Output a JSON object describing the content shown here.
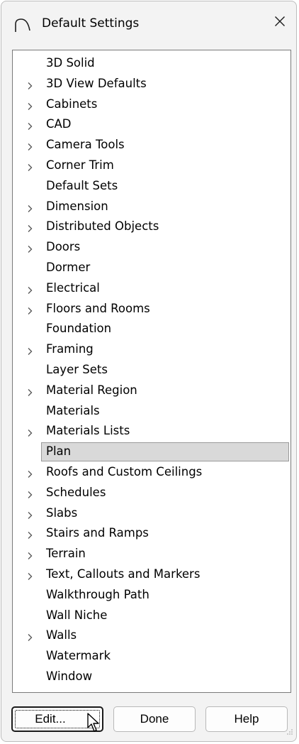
{
  "window": {
    "title": "Default Settings",
    "icon": "app-arc-icon",
    "close_icon": "close-icon"
  },
  "tree": {
    "items": [
      {
        "label": "3D Solid",
        "expandable": false
      },
      {
        "label": "3D View Defaults",
        "expandable": true
      },
      {
        "label": "Cabinets",
        "expandable": true
      },
      {
        "label": "CAD",
        "expandable": true
      },
      {
        "label": "Camera Tools",
        "expandable": true
      },
      {
        "label": "Corner Trim",
        "expandable": true
      },
      {
        "label": "Default Sets",
        "expandable": false
      },
      {
        "label": "Dimension",
        "expandable": true
      },
      {
        "label": "Distributed Objects",
        "expandable": true
      },
      {
        "label": "Doors",
        "expandable": true
      },
      {
        "label": "Dormer",
        "expandable": false
      },
      {
        "label": "Electrical",
        "expandable": true
      },
      {
        "label": "Floors and Rooms",
        "expandable": true
      },
      {
        "label": "Foundation",
        "expandable": false
      },
      {
        "label": "Framing",
        "expandable": true
      },
      {
        "label": "Layer Sets",
        "expandable": false
      },
      {
        "label": "Material Region",
        "expandable": true
      },
      {
        "label": "Materials",
        "expandable": false
      },
      {
        "label": "Materials Lists",
        "expandable": true
      },
      {
        "label": "Plan",
        "expandable": false,
        "selected": true
      },
      {
        "label": "Roofs and Custom Ceilings",
        "expandable": true
      },
      {
        "label": "Schedules",
        "expandable": true
      },
      {
        "label": "Slabs",
        "expandable": true
      },
      {
        "label": "Stairs and Ramps",
        "expandable": true
      },
      {
        "label": "Terrain",
        "expandable": true
      },
      {
        "label": "Text, Callouts and Markers",
        "expandable": true
      },
      {
        "label": "Walkthrough Path",
        "expandable": false
      },
      {
        "label": "Wall Niche",
        "expandable": false
      },
      {
        "label": "Walls",
        "expandable": true
      },
      {
        "label": "Watermark",
        "expandable": false
      },
      {
        "label": "Window",
        "expandable": false
      }
    ]
  },
  "buttons": {
    "edit_label": "Edit...",
    "done_label": "Done",
    "help_label": "Help"
  },
  "colors": {
    "window_bg": "#f3f3f3",
    "selection_bg": "#d9d9d9",
    "tree_border": "#7a7a7a"
  }
}
